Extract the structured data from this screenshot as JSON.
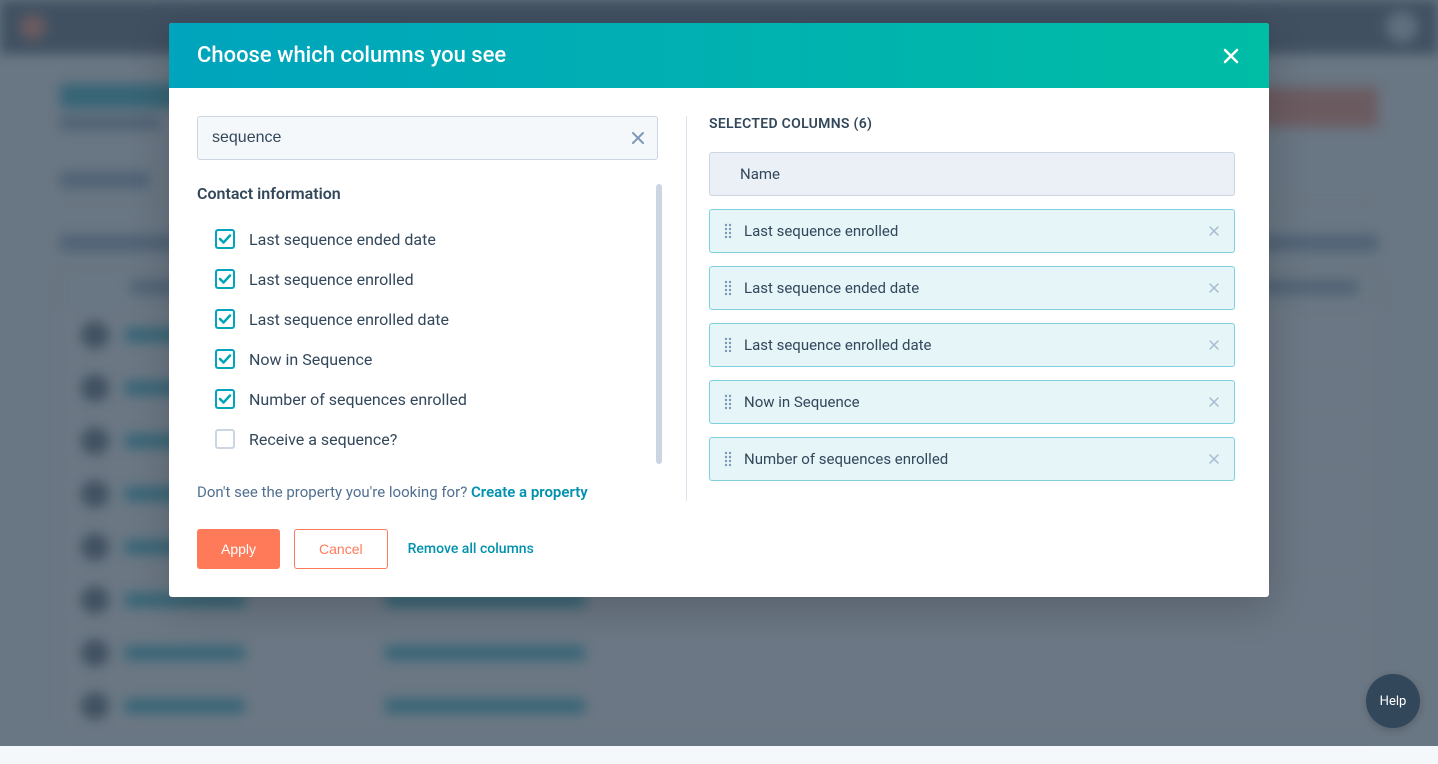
{
  "modal": {
    "title": "Choose which columns you see",
    "search_value": "sequence",
    "group_heading": "Contact information",
    "properties": [
      {
        "label": "Last sequence ended date",
        "checked": true
      },
      {
        "label": "Last sequence enrolled",
        "checked": true
      },
      {
        "label": "Last sequence enrolled date",
        "checked": true
      },
      {
        "label": "Now in Sequence",
        "checked": true
      },
      {
        "label": "Number of sequences enrolled",
        "checked": true
      },
      {
        "label": "Receive a sequence?",
        "checked": false
      }
    ],
    "help_text": "Don't see the property you're looking for? ",
    "help_link": "Create a property",
    "selected_heading": "SELECTED COLUMNS",
    "selected_count": "6",
    "selected": [
      {
        "label": "Name",
        "fixed": true
      },
      {
        "label": "Last sequence enrolled",
        "fixed": false
      },
      {
        "label": "Last sequence ended date",
        "fixed": false
      },
      {
        "label": "Last sequence enrolled date",
        "fixed": false
      },
      {
        "label": "Now in Sequence",
        "fixed": false
      },
      {
        "label": "Number of sequences enrolled",
        "fixed": false
      }
    ],
    "footer": {
      "apply": "Apply",
      "cancel": "Cancel",
      "remove_all": "Remove all columns"
    }
  },
  "help_float": "Help"
}
